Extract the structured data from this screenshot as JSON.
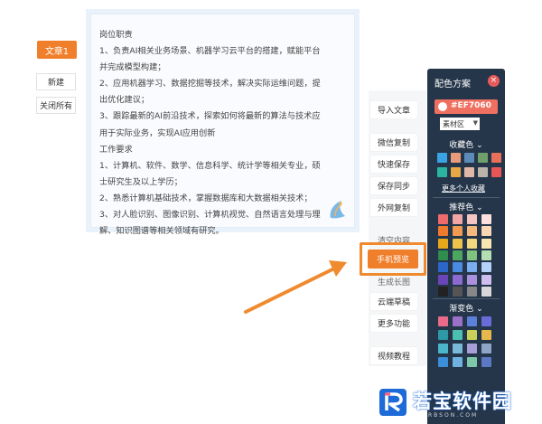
{
  "left_tabs": {
    "active_tab": "文章1",
    "new_label": "新建",
    "close_all_label": "关闭所有"
  },
  "document": {
    "lines": [
      "岗位职责",
      "1、负责AI相关业务场景、机器学习云平台的搭建，赋能平台",
      "并完成模型构建；",
      "2、应用机器学习、数据挖掘等技术，解决实际运维问题，提",
      "出优化建议；",
      "3、跟踪最新的AI前沿技术，探索如何将最新的算法与技术应",
      "用于实际业务，实现AI应用创新",
      "工作要求",
      "1、计算机、软件、数学、信息科学、统计学等相关专业，硕",
      "士研究生及以上学历；",
      "2、熟悉计算机基础技术，掌握数据库和大数据相关技术；",
      "3、对人脸识别、图像识别、计算机视觉、自然语言处理与理",
      "解、知识图谱等相关领域有研究。"
    ]
  },
  "tools": {
    "import": "导入文章",
    "wechat_copy": "微信复制",
    "quick_save": "快速保存",
    "save_sync": "保存同步",
    "external_copy": "外网复制",
    "clear": "清空内容",
    "mobile_preview": "手机预览",
    "gen_image": "生成长图",
    "cloud_draft": "云端草稿",
    "more": "更多功能",
    "video": "视频教程"
  },
  "color_panel": {
    "title": "配色方案",
    "close_icon": "×",
    "current_hex": "#EF7060",
    "material_select": "素材区",
    "favorites_heading": "收藏色",
    "more_favorites": "更多个人收藏",
    "recommended_heading": "推荐色",
    "gradient_heading": "渐变色",
    "favorite_colors": [
      "#3aa3e3",
      "#e89a7a",
      "#5b8bb8",
      "#6fa06a",
      "#e86f5a",
      "#2bb5a0",
      "#e7a845",
      "#e0b8a8",
      "#b9b3aa",
      "#e85555"
    ],
    "recommended_colors": [
      "#ee6b6b",
      "#f3a5a5",
      "#f7c4c4",
      "#fbe0de",
      "#ee7a2e",
      "#f29a50",
      "#f5b97b",
      "#fad6b5",
      "#e8a81c",
      "#efc34b",
      "#f3d67d",
      "#f8e7b1",
      "#2f8d4e",
      "#4ca660",
      "#80c37f",
      "#b6dfb1",
      "#2b67c9",
      "#4a8ae0",
      "#7aaef0",
      "#b4d1f7",
      "#6a45b8",
      "#8c6ad0",
      "#ab90de",
      "#d0bfee",
      "#222222",
      "#555555",
      "#888888",
      "#d8d8d8"
    ],
    "gradient_colors": [
      "#e86b8a",
      "#9a70c8",
      "#5c7fd9",
      "#6b6bd8",
      "#2e98a6",
      "#4cc0b0",
      "#c8d05a",
      "#e8b84c",
      "#4bb5c9",
      "#7ab9d8",
      "#a99fd8",
      "#8fa5c8",
      "#3b8ed8",
      "#6fb2e0",
      "#7dc7a8",
      "#5b78c4"
    ]
  },
  "watermark": {
    "brand": "若宝软件园",
    "url": "RBSON.COM"
  }
}
